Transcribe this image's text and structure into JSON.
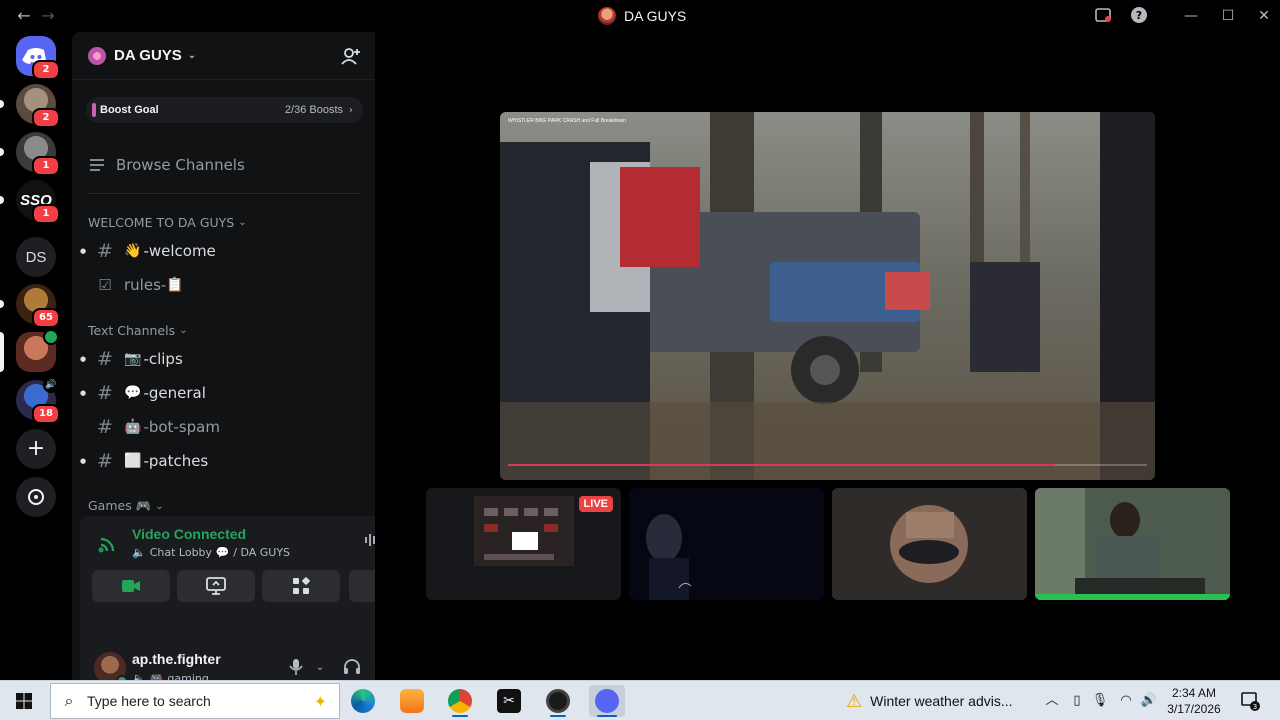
{
  "window": {
    "title": "DA GUYS",
    "back_glyph": "←",
    "forward_glyph": "→",
    "min_glyph": "—",
    "max_glyph": "☐",
    "close_glyph": "✕",
    "help_glyph": "?"
  },
  "rail": {
    "home_badge": "2",
    "servers": [
      {
        "name": "server-1",
        "badge": "2",
        "colors": [
          "#a58f7d",
          "#5b4a3d"
        ]
      },
      {
        "name": "server-2",
        "badge": "1",
        "colors": [
          "#8a8a8a",
          "#3b3b3b"
        ]
      },
      {
        "name": "server-ssq",
        "label": "SSQ",
        "badge": "1",
        "colors": [
          "#111111",
          "#111111"
        ]
      },
      {
        "name": "server-ds",
        "label": "DS"
      },
      {
        "name": "server-gamer",
        "badge": "65",
        "colors": [
          "#b07a3a",
          "#3a2212"
        ]
      },
      {
        "name": "server-da-guys",
        "colors": [
          "#c9775a",
          "#5b2b22"
        ]
      },
      {
        "name": "server-8",
        "badge": "18",
        "colors": [
          "#3c6bd0",
          "#2a2a4a"
        ]
      }
    ],
    "add_glyph": "+"
  },
  "sidebar": {
    "server_name": "DA GUYS",
    "boost_label": "Boost Goal",
    "boost_count": "2/36 Boosts",
    "browse_label": "Browse Channels",
    "categories": [
      {
        "label": "WELCOME TO DA GUYS"
      },
      {
        "label": "Text Channels"
      },
      {
        "label": "Games 🎮"
      }
    ],
    "channels": [
      {
        "emoji": "👋",
        "name": "-welcome",
        "unread": true
      },
      {
        "emoji": "📋",
        "name": "rules-",
        "unread": false
      },
      {
        "emoji": "📷",
        "name": "-clips",
        "unread": true
      },
      {
        "emoji": "💬",
        "name": "-general",
        "unread": true
      },
      {
        "emoji": "🤖",
        "name": "-bot-spam",
        "unread": false
      },
      {
        "emoji": "⬜",
        "name": "-patches",
        "unread": true
      }
    ]
  },
  "voice": {
    "status": "Video Connected",
    "channel": "Chat Lobby 💬",
    "server": "/ DA GUYS"
  },
  "user": {
    "name": "ap.the.fighter",
    "status": "gaming"
  },
  "stage": {
    "main_caption": "WHISTLER BIKE PARK CRASH and Full Breakdown",
    "live_label": "LIVE"
  },
  "taskbar": {
    "search_placeholder": "Type here to search",
    "weather_text": "Winter weather advis...",
    "time": "2:34 AM",
    "date": "3/17/2026",
    "notif_count": "3"
  },
  "colors": {
    "accent_green": "#23a55a",
    "badge_red": "#f23f43",
    "live_red": "#ed4245",
    "blurple": "#5865f2"
  }
}
